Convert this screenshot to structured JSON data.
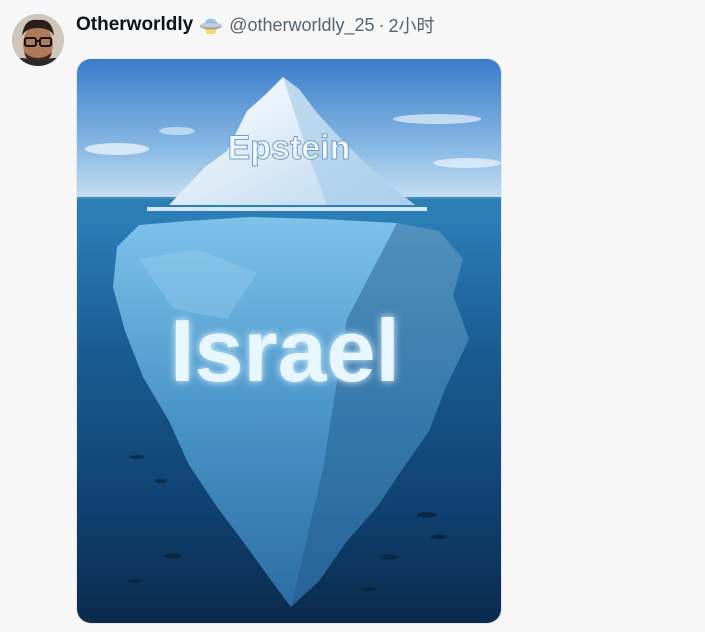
{
  "post": {
    "author": {
      "display_name": "Otherworldly",
      "handle": "@otherworldly_25",
      "badge_icon": "ufo-icon"
    },
    "separator": "·",
    "timestamp": "2小时",
    "image": {
      "top_label": "Epstein",
      "bottom_label": "Israel"
    }
  },
  "colors": {
    "name": "#0f1419",
    "meta": "#536471",
    "background": "#f7f7f8"
  }
}
